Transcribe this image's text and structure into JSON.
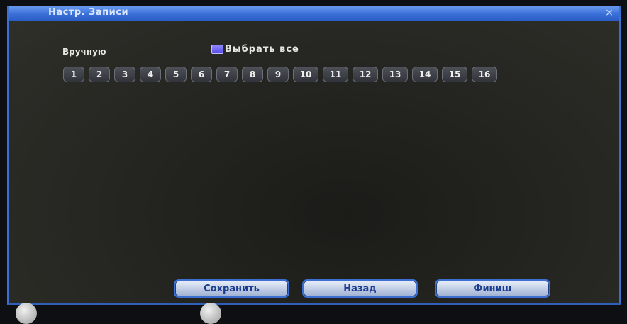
{
  "window": {
    "title": "Настр. Записи",
    "close_glyph": "×"
  },
  "record": {
    "mode_label": "Вручную",
    "select_all_label": "Выбрать все",
    "select_all_checked": true,
    "channels": [
      "1",
      "2",
      "3",
      "4",
      "5",
      "6",
      "7",
      "8",
      "9",
      "10",
      "11",
      "12",
      "13",
      "14",
      "15",
      "16"
    ]
  },
  "footer": {
    "save_label": "Сохранить",
    "back_label": "Назад",
    "finish_label": "Финиш"
  },
  "colors": {
    "frame_accent": "#3c6fd1",
    "checkbox": "#6a5ff0"
  }
}
